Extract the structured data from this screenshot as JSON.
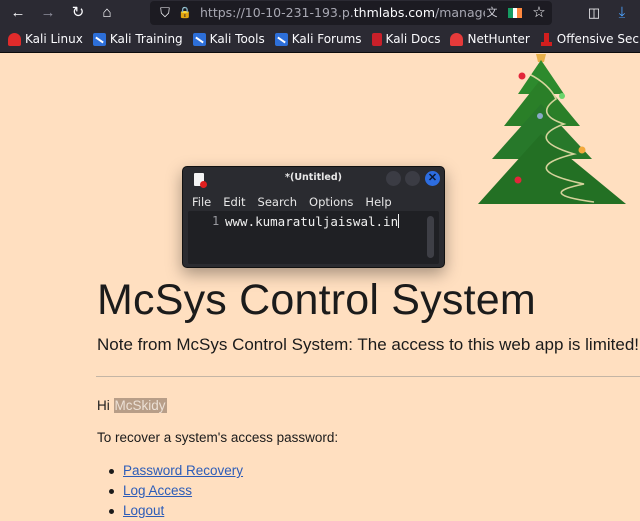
{
  "browser": {
    "url_prefix": "https://10-10-231-193.p.",
    "url_host": "thmlabs.com",
    "url_path": "/manage.php",
    "nav_icons": {
      "back": "←",
      "forward": "→",
      "reload": "↻",
      "home": "⌂",
      "shield": "⛉",
      "lock": "🔒",
      "translate": "文",
      "star": "☆",
      "pocket": "◫",
      "download": "⤓"
    },
    "flag_colors": [
      "#169b62",
      "#ffffff",
      "#ff883e"
    ],
    "bookmarks": [
      {
        "label": "Kali Linux",
        "icon": "kali"
      },
      {
        "label": "Kali Training",
        "icon": "blue"
      },
      {
        "label": "Kali Tools",
        "icon": "blue"
      },
      {
        "label": "Kali Forums",
        "icon": "blue"
      },
      {
        "label": "Kali Docs",
        "icon": "docs"
      },
      {
        "label": "NetHunter",
        "icon": "nh"
      },
      {
        "label": "Offensive Security",
        "icon": "os"
      },
      {
        "label": "",
        "icon": "os"
      }
    ]
  },
  "page": {
    "title": "McSys Control System",
    "note": "Note from McSys Control System: The access to this web app is limited!",
    "greeting_prefix": "Hi ",
    "username": "McSkidy",
    "instruction": "To recover a system's access password:",
    "links": [
      {
        "label": "Password Recovery"
      },
      {
        "label": "Log Access"
      },
      {
        "label": "Logout"
      }
    ],
    "background_color": "#ffdfc0"
  },
  "editor": {
    "title": "*(Untitled)",
    "menu": [
      "File",
      "Edit",
      "Search",
      "Options",
      "Help"
    ],
    "line_number": "1",
    "content": "www.kumaratuljaiswal.in",
    "close_glyph": "✕"
  }
}
